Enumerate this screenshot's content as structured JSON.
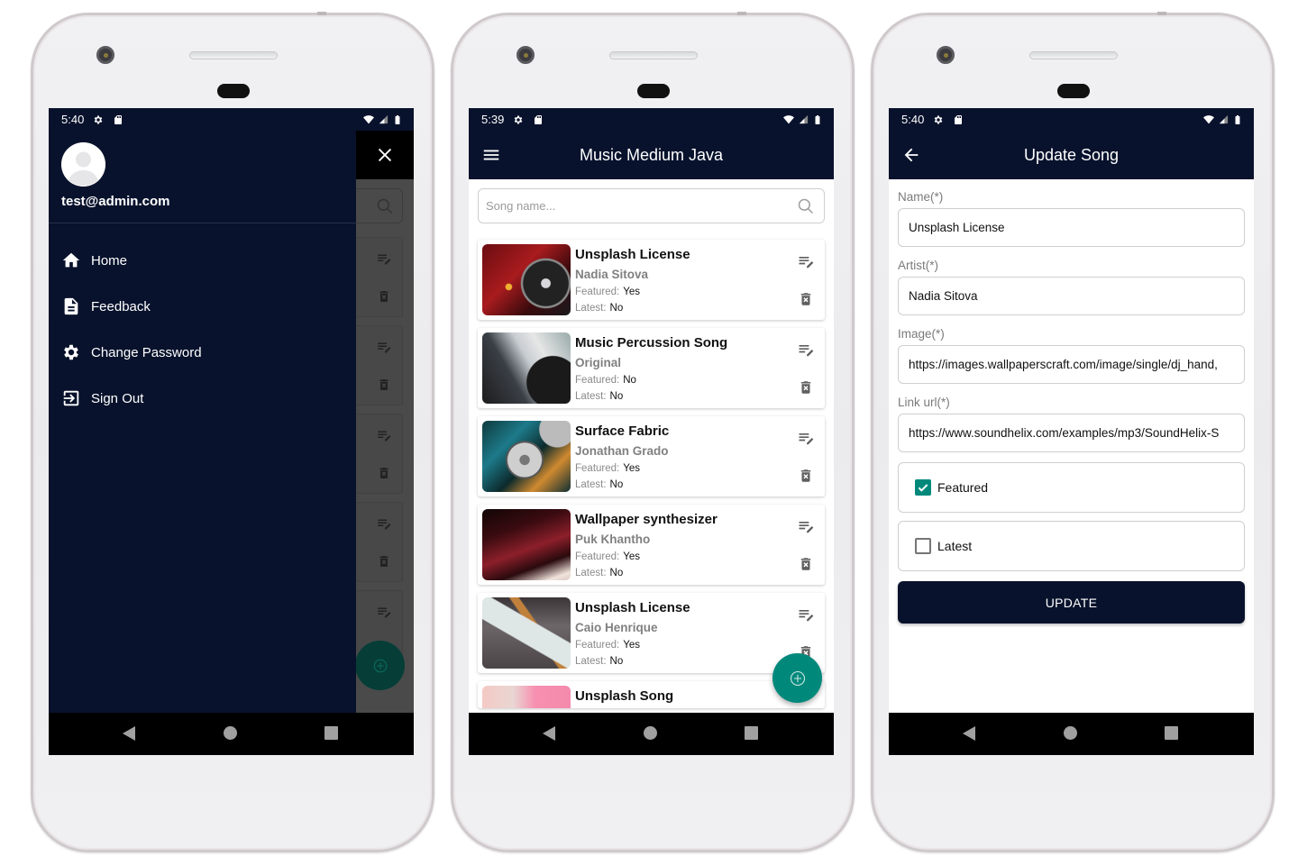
{
  "theme": {
    "primary": "#08122c",
    "accent": "#00897b",
    "scrim": "#4a4a4a"
  },
  "phone_drawer": {
    "status": {
      "time": "5:40"
    },
    "user_email": "test@admin.com",
    "menu": [
      {
        "label": "Home",
        "icon": "home-icon"
      },
      {
        "label": "Feedback",
        "icon": "document-icon"
      },
      {
        "label": "Change Password",
        "icon": "gear-icon"
      },
      {
        "label": "Sign Out",
        "icon": "sign-out-icon"
      }
    ],
    "close_icon": "close-icon"
  },
  "phone_list": {
    "status": {
      "time": "5:39"
    },
    "app_title": "Music Medium Java",
    "search": {
      "placeholder": "Song name...",
      "value": ""
    },
    "featured_label": "Featured:",
    "latest_label": "Latest:",
    "songs": [
      {
        "title": "Unsplash License",
        "artist": "Nadia Sitova",
        "featured": "Yes",
        "latest": "No"
      },
      {
        "title": "Music Percussion Song",
        "artist": "Original",
        "featured": "No",
        "latest": "No"
      },
      {
        "title": "Surface Fabric",
        "artist": "Jonathan Grado",
        "featured": "Yes",
        "latest": "No"
      },
      {
        "title": "Wallpaper synthesizer",
        "artist": "Puk Khantho",
        "featured": "Yes",
        "latest": "No"
      },
      {
        "title": "Unsplash License",
        "artist": "Caio Henrique",
        "featured": "Yes",
        "latest": "No"
      },
      {
        "title": "Unsplash Song"
      }
    ]
  },
  "phone_form": {
    "status": {
      "time": "5:40"
    },
    "title": "Update Song",
    "fields": {
      "name": {
        "label": "Name(*)",
        "value": "Unsplash License"
      },
      "artist": {
        "label": "Artist(*)",
        "value": "Nadia Sitova"
      },
      "image": {
        "label": "Image(*)",
        "value": "https://images.wallpaperscraft.com/image/single/dj_hand,"
      },
      "link": {
        "label": "Link url(*)",
        "value": "https://www.soundhelix.com/examples/mp3/SoundHelix-S"
      }
    },
    "featured": {
      "label": "Featured",
      "checked": true
    },
    "latest": {
      "label": "Latest",
      "checked": false
    },
    "update_label": "UPDATE"
  }
}
